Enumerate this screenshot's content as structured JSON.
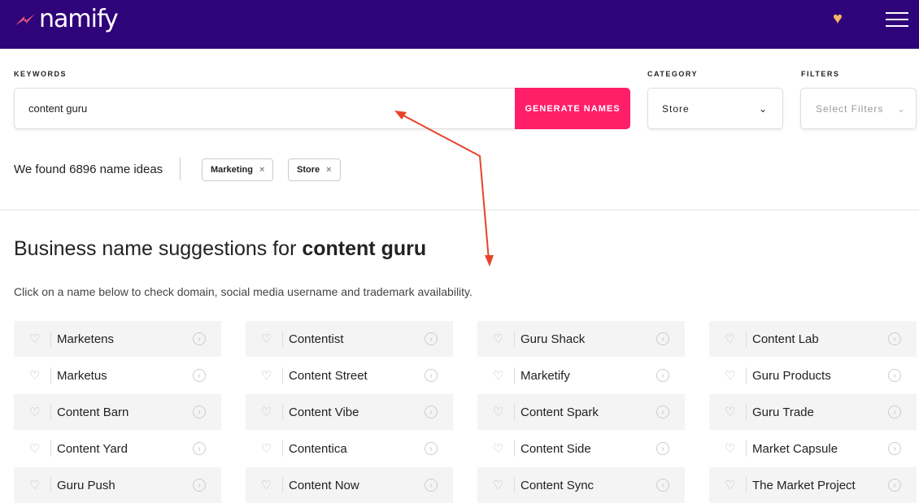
{
  "header": {
    "brand": "namify",
    "colors": {
      "bar": "#2f0379",
      "accent": "#ff1e68",
      "heart": "#f7b863"
    }
  },
  "search": {
    "keywords_label": "KEYWORDS",
    "keywords_value": "content guru",
    "generate_label": "GENERATE NAMES",
    "category_label": "CATEGORY",
    "category_value": "Store",
    "filters_label": "FILTERS",
    "filters_placeholder": "Select Filters"
  },
  "results": {
    "found_text": "We found 6896 name ideas",
    "tags": [
      "Marketing",
      "Store"
    ]
  },
  "suggestions": {
    "title_prefix": "Business name suggestions for ",
    "title_keyword": "content guru",
    "subtitle": "Click on a name below to check domain, social media username and trademark availability.",
    "columns": [
      [
        "Marketens",
        "Marketus",
        "Content Barn",
        "Content Yard",
        "Guru Push"
      ],
      [
        "Contentist",
        "Content Street",
        "Content Vibe",
        "Contentica",
        "Content Now"
      ],
      [
        "Guru Shack",
        "Marketify",
        "Content Spark",
        "Content Side",
        "Content Sync"
      ],
      [
        "Content Lab",
        "Guru Products",
        "Guru Trade",
        "Market Capsule",
        "The Market Project"
      ]
    ]
  }
}
